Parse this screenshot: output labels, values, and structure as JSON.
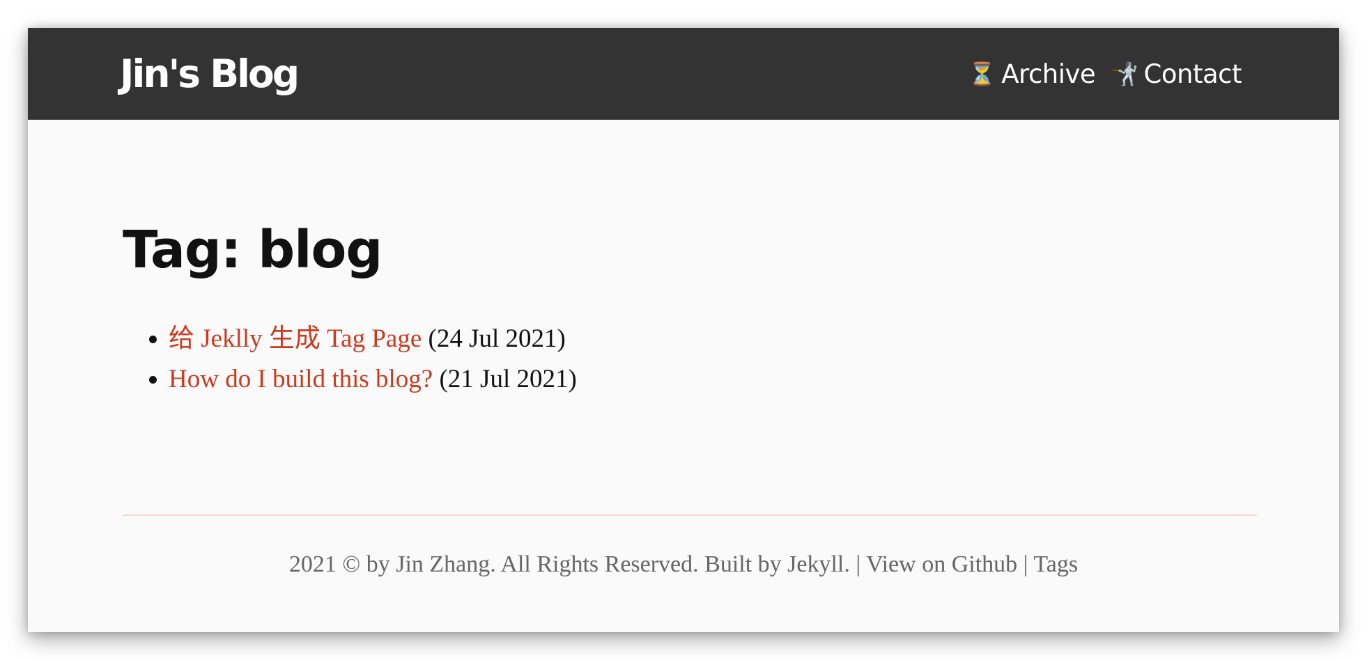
{
  "header": {
    "site_title": "Jin's Blog",
    "nav": [
      {
        "icon": "hourglass-icon",
        "glyph": "⏳",
        "label": "Archive"
      },
      {
        "icon": "fencer-icon",
        "glyph": "🤺",
        "label": "Contact"
      }
    ]
  },
  "main": {
    "title": "Tag: blog",
    "posts": [
      {
        "title": "给 Jeklly 生成 Tag Page",
        "date": "(24 Jul 2021)"
      },
      {
        "title": "How do I build this blog?",
        "date": "(21 Jul 2021)"
      }
    ]
  },
  "footer": {
    "copyright": "2021 © by Jin Zhang. All Rights Reserved. Built by Jekyll.",
    "separator": "|",
    "github_label": "View on Github",
    "tags_label": "Tags"
  },
  "colors": {
    "navbar_bg": "#333333",
    "link": "#cc3a1d",
    "page_bg": "#fafafa",
    "divider": "#f3d7cf"
  }
}
